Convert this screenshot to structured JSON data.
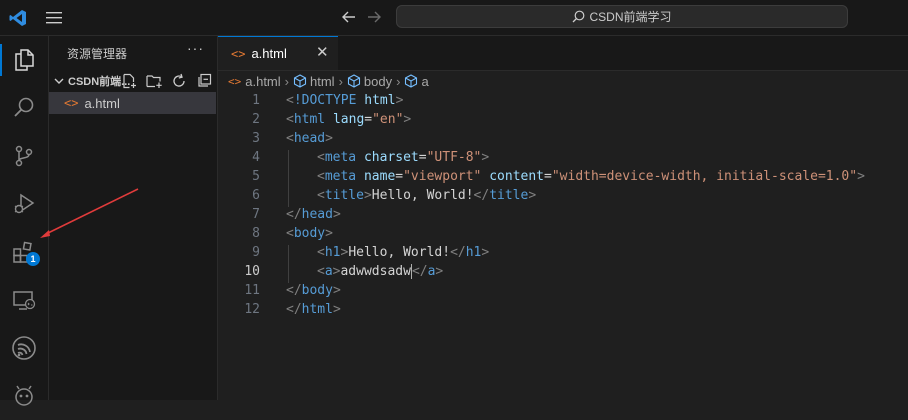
{
  "titlebar": {
    "search_text": "CSDN前端学习"
  },
  "activity_bar": {
    "extensions_badge": "1"
  },
  "sidebar": {
    "title": "资源管理器",
    "more": "···",
    "folder_name": "CSDN前端...",
    "files": [
      {
        "name": "a.html"
      }
    ]
  },
  "tab": {
    "label": "a.html",
    "close": "✕"
  },
  "breadcrumb": {
    "items": [
      "a.html",
      "html",
      "body",
      "a"
    ],
    "separator": "›"
  },
  "editor": {
    "active_line": 10,
    "lines": [
      {
        "number": "1",
        "indent": 0,
        "tokens": [
          [
            "bracket",
            "<"
          ],
          [
            "tag",
            "!DOCTYPE"
          ],
          [
            "text",
            " "
          ],
          [
            "attr",
            "html"
          ],
          [
            "bracket",
            ">"
          ]
        ]
      },
      {
        "number": "2",
        "indent": 0,
        "tokens": [
          [
            "bracket",
            "<"
          ],
          [
            "tag",
            "html"
          ],
          [
            "text",
            " "
          ],
          [
            "attr",
            "lang"
          ],
          [
            "eq",
            "="
          ],
          [
            "str",
            "\"en\""
          ],
          [
            "bracket",
            ">"
          ]
        ]
      },
      {
        "number": "3",
        "indent": 0,
        "tokens": [
          [
            "bracket",
            "<"
          ],
          [
            "tag",
            "head"
          ],
          [
            "bracket",
            ">"
          ]
        ]
      },
      {
        "number": "4",
        "indent": 1,
        "tokens": [
          [
            "bracket",
            "<"
          ],
          [
            "tag",
            "meta"
          ],
          [
            "text",
            " "
          ],
          [
            "attr",
            "charset"
          ],
          [
            "eq",
            "="
          ],
          [
            "str",
            "\"UTF-8\""
          ],
          [
            "bracket",
            ">"
          ]
        ]
      },
      {
        "number": "5",
        "indent": 1,
        "tokens": [
          [
            "bracket",
            "<"
          ],
          [
            "tag",
            "meta"
          ],
          [
            "text",
            " "
          ],
          [
            "attr",
            "name"
          ],
          [
            "eq",
            "="
          ],
          [
            "str",
            "\"viewport\""
          ],
          [
            "text",
            " "
          ],
          [
            "attr",
            "content"
          ],
          [
            "eq",
            "="
          ],
          [
            "str",
            "\"width=device-width, initial-scale=1.0\""
          ],
          [
            "bracket",
            ">"
          ]
        ]
      },
      {
        "number": "6",
        "indent": 1,
        "tokens": [
          [
            "bracket",
            "<"
          ],
          [
            "tag",
            "title"
          ],
          [
            "bracket",
            ">"
          ],
          [
            "text",
            "Hello, World!"
          ],
          [
            "bracket",
            "</"
          ],
          [
            "tag",
            "title"
          ],
          [
            "bracket",
            ">"
          ]
        ]
      },
      {
        "number": "7",
        "indent": 0,
        "tokens": [
          [
            "bracket",
            "</"
          ],
          [
            "tag",
            "head"
          ],
          [
            "bracket",
            ">"
          ]
        ]
      },
      {
        "number": "8",
        "indent": 0,
        "tokens": [
          [
            "bracket",
            "<"
          ],
          [
            "tag",
            "body"
          ],
          [
            "bracket",
            ">"
          ]
        ]
      },
      {
        "number": "9",
        "indent": 1,
        "tokens": [
          [
            "bracket",
            "<"
          ],
          [
            "tag",
            "h1"
          ],
          [
            "bracket",
            ">"
          ],
          [
            "text",
            "Hello, World!"
          ],
          [
            "bracket",
            "</"
          ],
          [
            "tag",
            "h1"
          ],
          [
            "bracket",
            ">"
          ]
        ]
      },
      {
        "number": "10",
        "indent": 1,
        "tokens": [
          [
            "bracket",
            "<"
          ],
          [
            "tag",
            "a"
          ],
          [
            "bracket",
            ">"
          ],
          [
            "text",
            "adwwdsadw"
          ],
          [
            "cursor",
            ""
          ],
          [
            "bracket",
            "</"
          ],
          [
            "tag",
            "a"
          ],
          [
            "bracket",
            ">"
          ]
        ]
      },
      {
        "number": "11",
        "indent": 0,
        "tokens": [
          [
            "bracket",
            "</"
          ],
          [
            "tag",
            "body"
          ],
          [
            "bracket",
            ">"
          ]
        ]
      },
      {
        "number": "12",
        "indent": 0,
        "tokens": [
          [
            "bracket",
            "</"
          ],
          [
            "tag",
            "html"
          ],
          [
            "bracket",
            ">"
          ]
        ]
      }
    ]
  },
  "colors": {
    "accent": "#0078d4",
    "annotation_arrow": "#e03b3b",
    "html_file_icon": "#e37933"
  },
  "icons": {
    "titlebar": [
      "vscode-logo-icon",
      "menu-icon",
      "arrow-left-icon",
      "arrow-right-icon",
      "search-icon"
    ],
    "activity_bar": [
      "files-icon",
      "search-icon",
      "source-control-icon",
      "run-debug-icon",
      "extensions-icon",
      "remote-explorer-icon",
      "esp-idf-icon",
      "copilot-icon"
    ],
    "explorer_actions": [
      "new-file-icon",
      "new-folder-icon",
      "refresh-icon",
      "collapse-all-icon"
    ]
  }
}
